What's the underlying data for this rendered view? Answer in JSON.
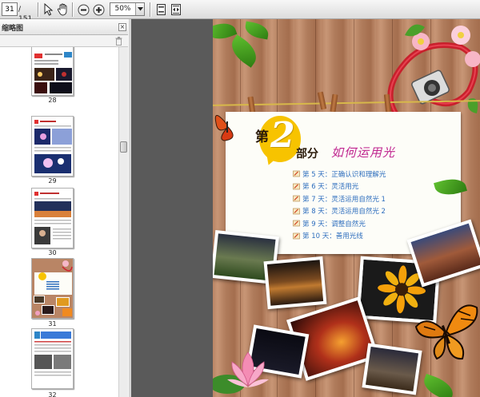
{
  "toolbar": {
    "page_number": "31",
    "page_total": "/ 151",
    "zoom": "50%"
  },
  "sidebar": {
    "title": "缩略图",
    "close_glyph": "×",
    "thumbnails": [
      {
        "label": "28"
      },
      {
        "label": "29"
      },
      {
        "label": "30"
      },
      {
        "label": "31"
      },
      {
        "label": "32"
      }
    ]
  },
  "page": {
    "di": "第",
    "number": "2",
    "bufen": "部分",
    "subtitle": "如何运用光",
    "toc": [
      "第 5 天：正确认识和理解光",
      "第 6 天：灵活用光",
      "第 7 天：灵活运用自然光 1",
      "第 8 天：灵活运用自然光 2",
      "第 9 天：调整自然光",
      "第 10 天：善用光线"
    ]
  },
  "colors": {
    "toc_text": "#2f6fbe",
    "subtitle": "#c0258f",
    "badge": "#f7c300",
    "viewer_bg": "#5a5a5a"
  },
  "icons": [
    "select-cursor-icon",
    "hand-tool-icon",
    "zoom-out-icon",
    "zoom-in-icon",
    "fit-page-icon",
    "fit-width-icon",
    "trash-icon"
  ]
}
